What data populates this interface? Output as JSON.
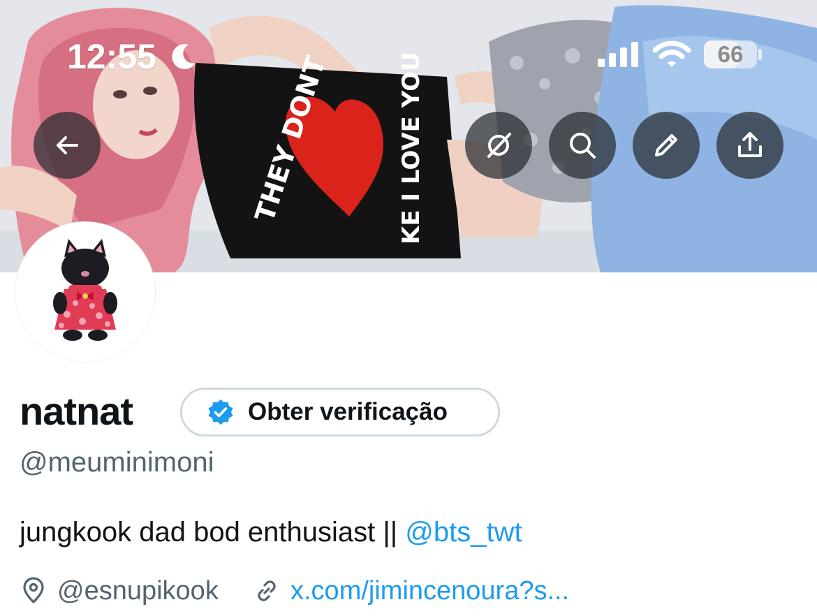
{
  "status_bar": {
    "time": "12:55",
    "battery_percent": "66",
    "battery_level": 0.66,
    "icons": [
      "moon-icon",
      "cellular-signal-icon",
      "wifi-icon",
      "battery-icon"
    ]
  },
  "header_actions": {
    "back": "arrow-left-icon",
    "grok": "grok-icon",
    "search": "search-icon",
    "edit": "pencil-icon",
    "share": "share-icon"
  },
  "profile": {
    "display_name": "natnat",
    "verification_chip_label": "Obter verificação",
    "handle": "@meuminimoni",
    "bio_text": "jungkook dad bod enthusiast || ",
    "bio_mention": "@bts_twt",
    "location": "@esnupikook",
    "website": "x.com/jimincenoura?s..."
  },
  "colors": {
    "accent": "#1d9bf0",
    "text_primary": "#0f1419",
    "text_secondary": "#536471",
    "border": "#cfd9de",
    "button_overlay": "#272c30"
  }
}
